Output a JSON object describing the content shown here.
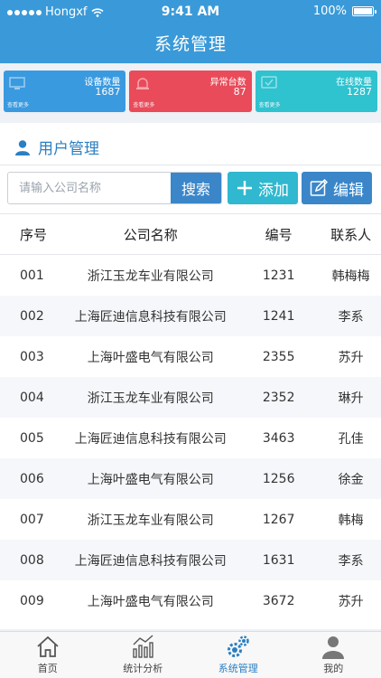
{
  "status_bar": {
    "carrier": "Hongxf",
    "time": "9:41 AM",
    "battery": "100%"
  },
  "nav": {
    "title": "系统管理"
  },
  "stats": [
    {
      "label": "设备数量",
      "value": "1687",
      "more": "查看更多",
      "color": "#3a9ae0",
      "icon": "device-icon"
    },
    {
      "label": "异常台数",
      "value": "87",
      "more": "查看更多",
      "color": "#e94b5a",
      "icon": "alarm-icon"
    },
    {
      "label": "在线数量",
      "value": "1287",
      "more": "查看更多",
      "color": "#2fc2cf",
      "icon": "online-icon"
    }
  ],
  "section": {
    "title": "用户管理"
  },
  "search": {
    "placeholder": "请输入公司名称",
    "button": "搜索"
  },
  "actions": {
    "add": "添加",
    "edit": "编辑"
  },
  "table": {
    "headers": [
      "序号",
      "公司名称",
      "编号",
      "联系人"
    ],
    "rows": [
      [
        "001",
        "浙江玉龙车业有限公司",
        "1231",
        "韩梅梅"
      ],
      [
        "002",
        "上海匠迪信息科技有限公司",
        "1241",
        "李系"
      ],
      [
        "003",
        "上海叶盛电气有限公司",
        "2355",
        "苏升"
      ],
      [
        "004",
        "浙江玉龙车业有限公司",
        "2352",
        "琳升"
      ],
      [
        "005",
        "上海匠迪信息科技有限公司",
        "3463",
        "孔佳"
      ],
      [
        "006",
        "上海叶盛电气有限公司",
        "1256",
        "徐金"
      ],
      [
        "007",
        "浙江玉龙车业有限公司",
        "1267",
        "韩梅"
      ],
      [
        "008",
        "上海匠迪信息科技有限公司",
        "1631",
        "李系"
      ],
      [
        "009",
        "上海叶盛电气有限公司",
        "3672",
        "苏升"
      ]
    ]
  },
  "tabbar": [
    {
      "label": "首页",
      "icon": "home-icon",
      "active": false
    },
    {
      "label": "统计分析",
      "icon": "chart-icon",
      "active": false
    },
    {
      "label": "系统管理",
      "icon": "gears-icon",
      "active": true
    },
    {
      "label": "我的",
      "icon": "user-icon",
      "active": false
    }
  ],
  "colors": {
    "primary": "#3a9ad9",
    "accent": "#2fb8cf",
    "active_tab": "#2a7fc2"
  }
}
